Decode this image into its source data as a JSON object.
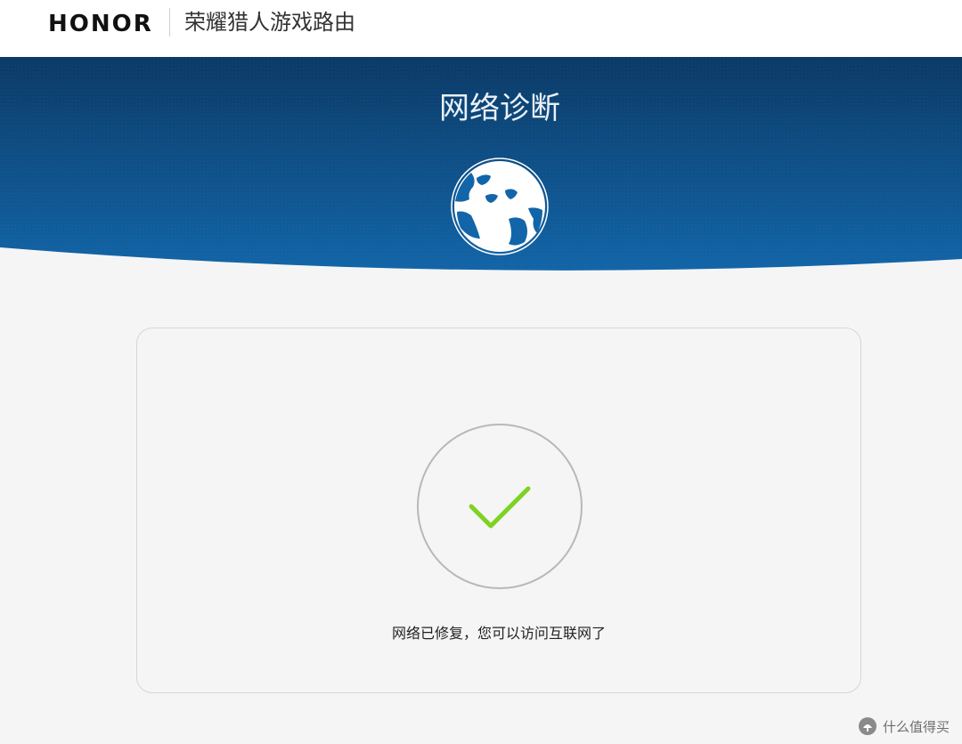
{
  "header": {
    "brand": "HONOR",
    "product_name": "荣耀猎人游戏路由"
  },
  "hero": {
    "title": "网络诊断",
    "icon": "globe-icon",
    "background_top_color": "#0b3a66",
    "background_bottom_color": "#1265a8"
  },
  "result": {
    "status_icon": "checkmark-icon",
    "status_color": "#7ed321",
    "message": "网络已修复，您可以访问互联网了"
  },
  "watermark": {
    "icon": "site-logo-icon",
    "text": "什么值得买"
  }
}
